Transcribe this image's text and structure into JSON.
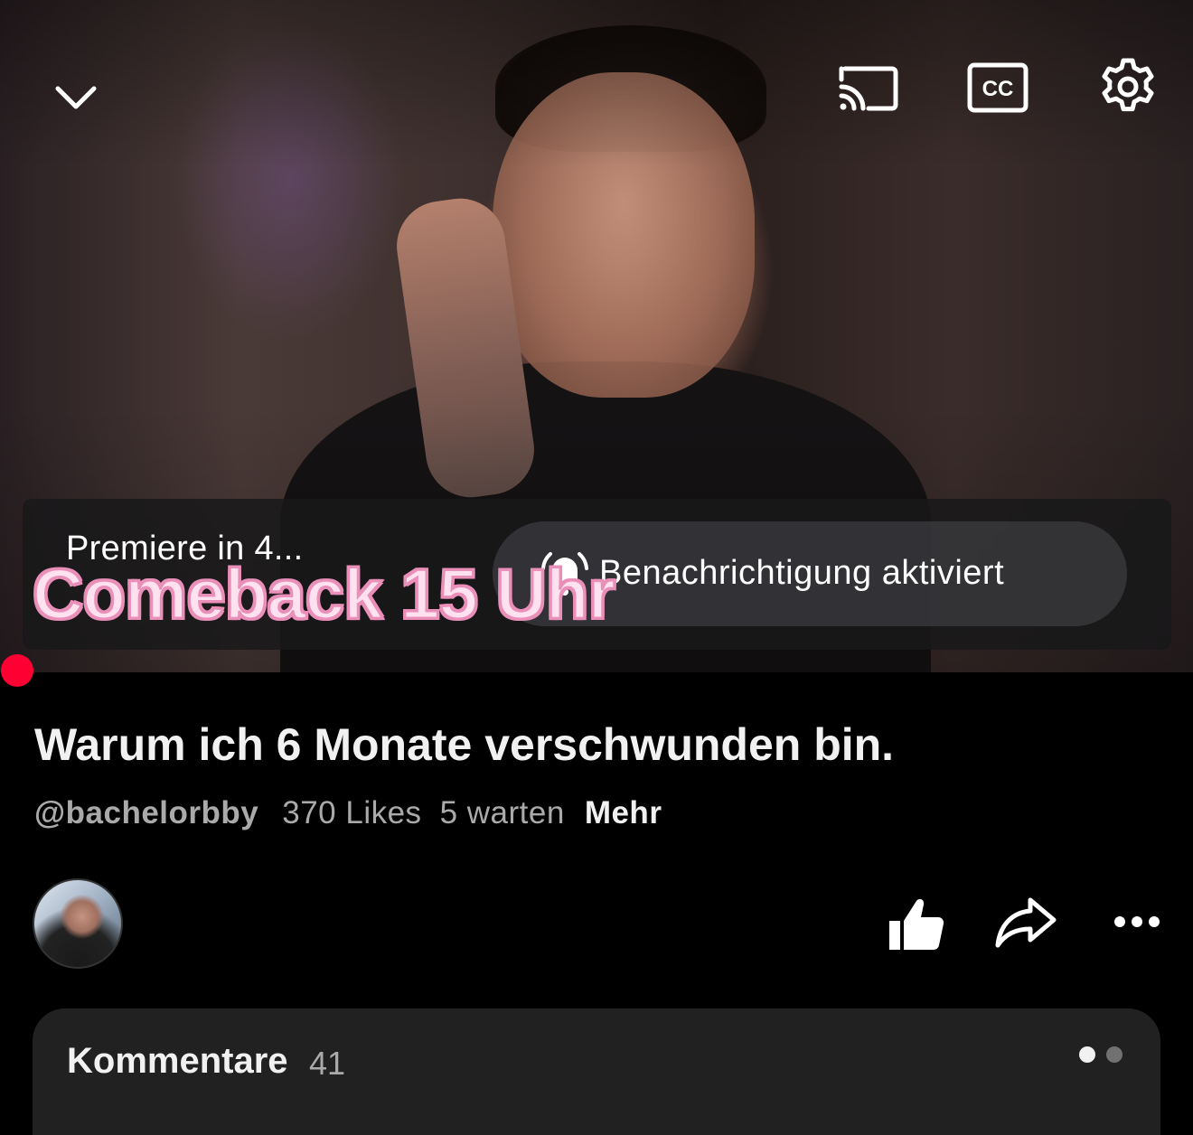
{
  "player": {
    "premiere_label": "Premiere in 4...",
    "notification_label": "Benachrichtigung aktiviert",
    "overlay_text": "Comeback 15 Uhr"
  },
  "video": {
    "title": "Warum ich 6 Monate verschwunden bin.",
    "channel_handle": "@bachelorbby",
    "likes": "370 Likes",
    "waiting": "5 warten",
    "more": "Mehr"
  },
  "comments": {
    "title": "Kommentare",
    "count": "41"
  },
  "icons": {
    "collapse": "chevron-down-icon",
    "cast": "cast-icon",
    "cc": "closed-captions-icon",
    "settings": "gear-icon",
    "notify": "bell-ringing-icon",
    "like": "thumbs-up-icon",
    "share": "share-arrow-icon",
    "more": "more-horizontal-icon"
  },
  "colors": {
    "progress": "#ff0033",
    "overlay_fill": "#ffe1ef",
    "overlay_stroke": "#e98fb8"
  }
}
